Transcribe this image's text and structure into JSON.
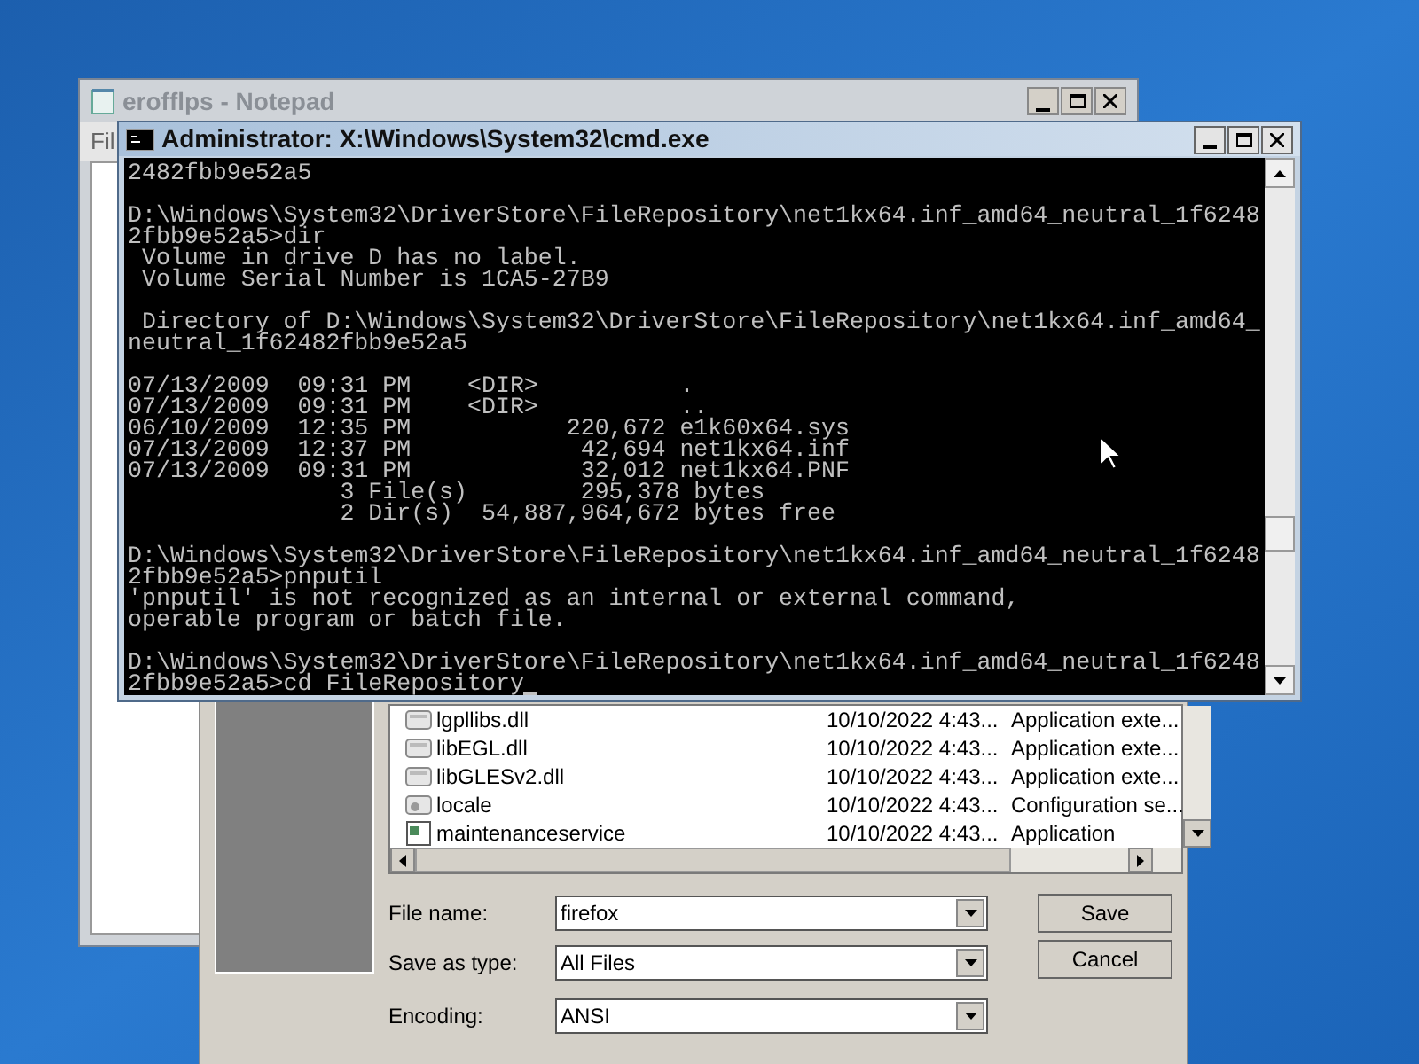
{
  "notepad": {
    "title": "erofflps - Notepad",
    "menu": [
      "Fil"
    ]
  },
  "save_dialog": {
    "files": [
      {
        "kind": "dll",
        "name": "lgpllibs.dll",
        "date": "10/10/2022 4:43...",
        "type": "Application exte..."
      },
      {
        "kind": "dll",
        "name": "libEGL.dll",
        "date": "10/10/2022 4:43...",
        "type": "Application exte..."
      },
      {
        "kind": "dll",
        "name": "libGLESv2.dll",
        "date": "10/10/2022 4:43...",
        "type": "Application exte..."
      },
      {
        "kind": "config",
        "name": "locale",
        "date": "10/10/2022 4:43...",
        "type": "Configuration se..."
      },
      {
        "kind": "app",
        "name": "maintenanceservice",
        "date": "10/10/2022 4:43...",
        "type": "Application"
      }
    ],
    "fields": [
      {
        "label": "File name:",
        "value": "firefox"
      },
      {
        "label": "Save as type:",
        "value": "All Files"
      },
      {
        "label": "Encoding:",
        "value": "ANSI"
      }
    ],
    "buttons": [
      "Save",
      "Cancel"
    ]
  },
  "cmd": {
    "title": "Administrator: X:\\Windows\\System32\\cmd.exe",
    "cursor_visible": true,
    "blocks": [
      [
        "2482fbb9e52a5"
      ],
      [
        "D:\\Windows\\System32\\DriverStore\\FileRepository\\net1kx64.inf_amd64_neutral_1f6248",
        "2fbb9e52a5>dir",
        " Volume in drive D has no label.",
        " Volume Serial Number is 1CA5-27B9"
      ],
      [
        " Directory of D:\\Windows\\System32\\DriverStore\\FileRepository\\net1kx64.inf_amd64_",
        "neutral_1f62482fbb9e52a5"
      ],
      [
        "07/13/2009  09:31 PM    <DIR>          .",
        "07/13/2009  09:31 PM    <DIR>          ..",
        "06/10/2009  12:35 PM           220,672 e1k60x64.sys",
        "07/13/2009  12:37 PM            42,694 net1kx64.inf",
        "07/13/2009  09:31 PM            32,012 net1kx64.PNF",
        "               3 File(s)        295,378 bytes",
        "               2 Dir(s)  54,887,964,672 bytes free"
      ],
      [
        "D:\\Windows\\System32\\DriverStore\\FileRepository\\net1kx64.inf_amd64_neutral_1f6248",
        "2fbb9e52a5>pnputil",
        "'pnputil' is not recognized as an internal or external command,",
        "operable program or batch file."
      ],
      [
        "D:\\Windows\\System32\\DriverStore\\FileRepository\\net1kx64.inf_amd64_neutral_1f6248",
        "2fbb9e52a5>cd FileRepository"
      ]
    ]
  }
}
